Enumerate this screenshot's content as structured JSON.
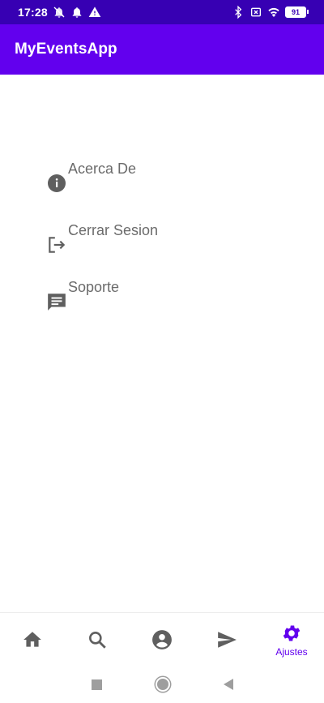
{
  "status_bar": {
    "time": "17:28",
    "battery": "91"
  },
  "app_bar": {
    "title": "MyEventsApp"
  },
  "menu": [
    {
      "label": "Acerca De",
      "icon": "info-icon"
    },
    {
      "label": "Cerrar Sesion",
      "icon": "logout-icon"
    },
    {
      "label": "Soporte",
      "icon": "message-icon"
    }
  ],
  "bottom_nav": {
    "items": [
      {
        "icon": "home-icon",
        "label": ""
      },
      {
        "icon": "search-icon",
        "label": ""
      },
      {
        "icon": "account-icon",
        "label": ""
      },
      {
        "icon": "send-icon",
        "label": ""
      },
      {
        "icon": "gear-icon",
        "label": "Ajustes",
        "active": true
      }
    ]
  },
  "colors": {
    "status_bar": "#3700b3",
    "app_bar": "#6200ee",
    "accent": "#6200ee",
    "icon_gray": "#5f5f5f"
  }
}
